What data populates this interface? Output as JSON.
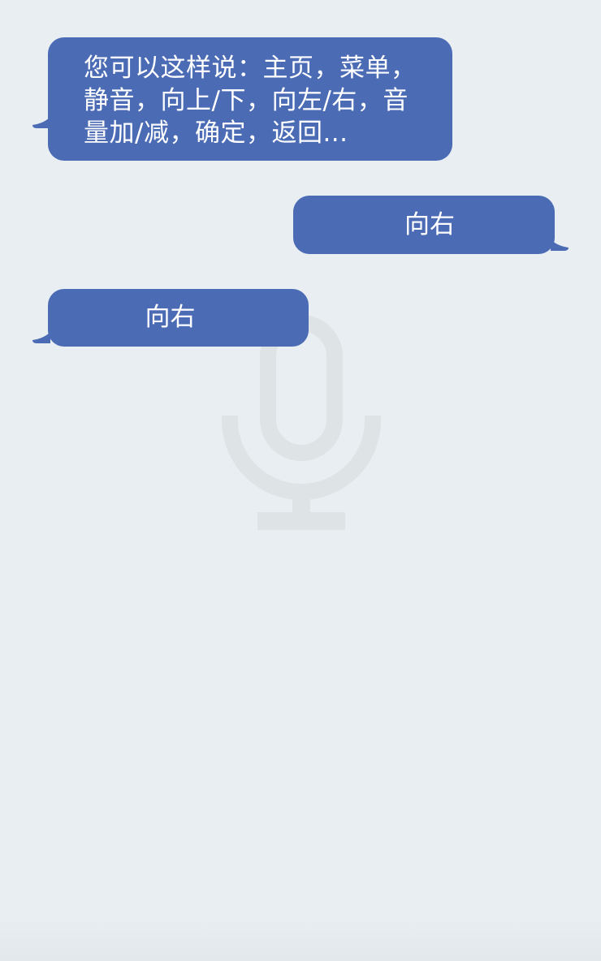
{
  "conversation": {
    "hint": "您可以这样说：主页，菜单，静音，向上/下，向左/右，音量加/减，确定，返回...",
    "user_message": "向右",
    "assistant_reply": "向右"
  },
  "watermark": {
    "icon": "microphone-icon"
  },
  "colors": {
    "background": "#e8eef2",
    "bubble": "#4b6bb5",
    "bubble_text": "#ffffff",
    "watermark": "#dde3e6"
  }
}
